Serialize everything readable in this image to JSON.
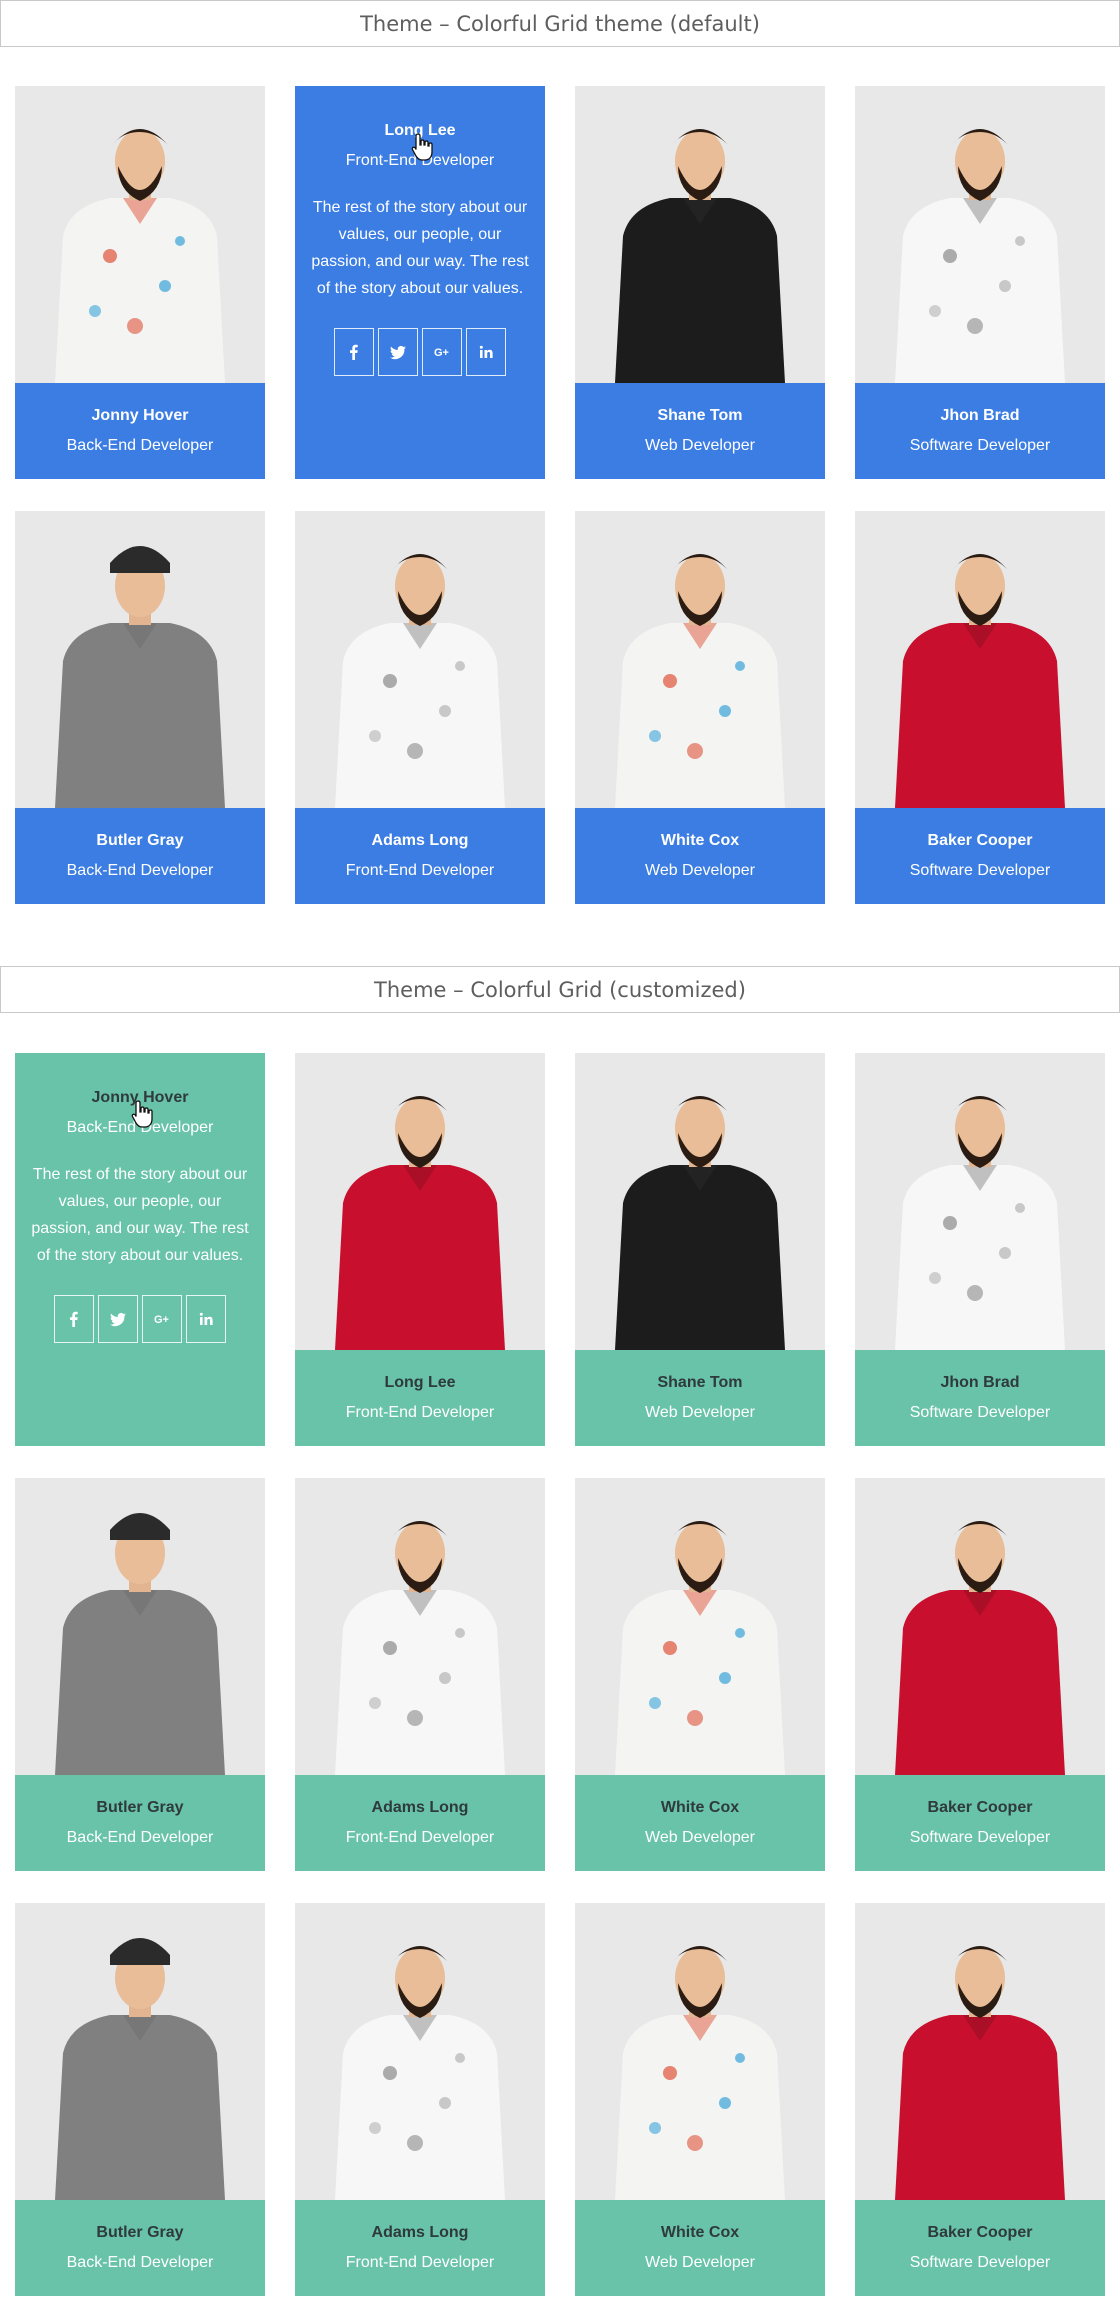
{
  "sections": [
    {
      "title": "Theme – Colorful Grid theme (default)",
      "accent": "#3b7de3",
      "hover_card": {
        "name": "Long Lee",
        "role": "Front-End Developer",
        "text": "The rest of the story about our values, our people, our passion, and our way. The rest of the story about our values.",
        "socials": [
          "facebook-icon",
          "twitter-icon",
          "google-plus-icon",
          "linkedin-icon"
        ]
      },
      "cards": [
        {
          "name": "Jonny Hover",
          "role": "Back-End Developer",
          "outfit": "patterned-shirt"
        },
        {
          "name": "Shane Tom",
          "role": "Web Developer",
          "outfit": "black-polo"
        },
        {
          "name": "Jhon Brad",
          "role": "Software Developer",
          "outfit": "floral-tee"
        },
        {
          "name": "Butler Gray",
          "role": "Back-End Developer",
          "outfit": "grey-henley"
        },
        {
          "name": "Adams Long",
          "role": "Front-End Developer",
          "outfit": "floral-tee"
        },
        {
          "name": "White Cox",
          "role": "Web Developer",
          "outfit": "patterned-shirt"
        },
        {
          "name": "Baker Cooper",
          "role": "Software Developer",
          "outfit": "red-jacket"
        }
      ]
    },
    {
      "title": "Theme – Colorful Grid (customized)",
      "accent": "#68c3a9",
      "hover_card": {
        "name": "Jonny Hover",
        "role": "Back-End Developer",
        "text": "The rest of the story about our values, our people, our passion, and our way. The rest of the story about our values.",
        "socials": [
          "facebook-icon",
          "twitter-icon",
          "google-plus-icon",
          "linkedin-icon"
        ]
      },
      "cards": [
        {
          "name": "Long Lee",
          "role": "Front-End Developer",
          "outfit": "red-jacket"
        },
        {
          "name": "Shane Tom",
          "role": "Web Developer",
          "outfit": "black-polo"
        },
        {
          "name": "Jhon Brad",
          "role": "Software Developer",
          "outfit": "floral-tee"
        },
        {
          "name": "Butler Gray",
          "role": "Back-End Developer",
          "outfit": "grey-henley"
        },
        {
          "name": "Adams Long",
          "role": "Front-End Developer",
          "outfit": "floral-tee"
        },
        {
          "name": "White Cox",
          "role": "Web Developer",
          "outfit": "patterned-shirt"
        },
        {
          "name": "Baker Cooper",
          "role": "Software Developer",
          "outfit": "red-jacket"
        },
        {
          "name": "Butler Gray",
          "role": "Back-End Developer",
          "outfit": "grey-henley"
        },
        {
          "name": "Adams Long",
          "role": "Front-End Developer",
          "outfit": "floral-tee"
        },
        {
          "name": "White Cox",
          "role": "Web Developer",
          "outfit": "patterned-shirt"
        },
        {
          "name": "Baker Cooper",
          "role": "Software Developer",
          "outfit": "red-jacket"
        }
      ]
    }
  ]
}
